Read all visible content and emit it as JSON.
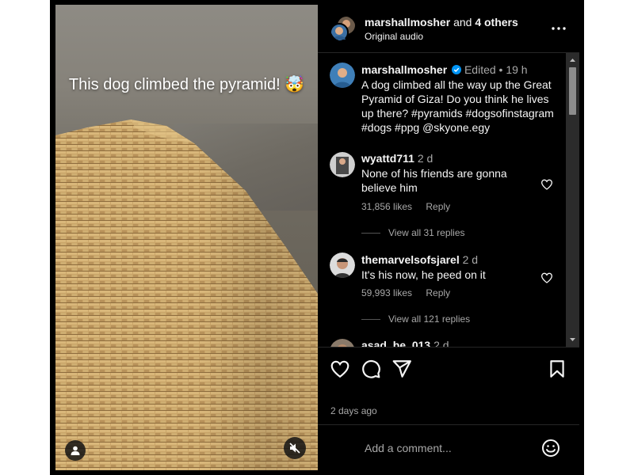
{
  "video": {
    "caption": "This dog climbed the pyramid! 🤯"
  },
  "header": {
    "username": "marshallmosher",
    "and_text": "and",
    "others": "4 others",
    "audio": "Original audio"
  },
  "post": {
    "username": "marshallmosher",
    "edited": "Edited",
    "dot": "•",
    "time": "19 h",
    "text": "A dog climbed all the way up the Great Pyramid of Giza! Do you think he lives up there? #pyramids #dogsofinstagram #dogs #ppg @skyone.egy"
  },
  "comments": [
    {
      "username": "wyattd711",
      "time": "2 d",
      "text": "None of his friends are gonna believe him",
      "likes": "31,856 likes",
      "reply": "Reply",
      "view_replies": "View all 31 replies"
    },
    {
      "username": "themarvelsofsjarel",
      "time": "2 d",
      "text": "It's his now, he peed on it",
      "likes": "59,993 likes",
      "reply": "Reply",
      "view_replies": "View all 121 replies"
    },
    {
      "username": "asad_be_013",
      "time": "2 d"
    }
  ],
  "footer": {
    "date": "2 days ago",
    "comment_placeholder": "Add a comment..."
  },
  "colors": {
    "background": "#000000",
    "text": "#f5f5f5",
    "muted": "#a8a8a8",
    "verified": "#0095f6"
  },
  "icons": {
    "more": "more-horizontal-icon",
    "like": "heart-icon",
    "comment": "comment-icon",
    "share": "share-icon",
    "save": "bookmark-icon",
    "emoji": "emoji-icon",
    "user": "user-icon",
    "mute": "speaker-muted-icon",
    "verified": "verified-badge-icon"
  }
}
